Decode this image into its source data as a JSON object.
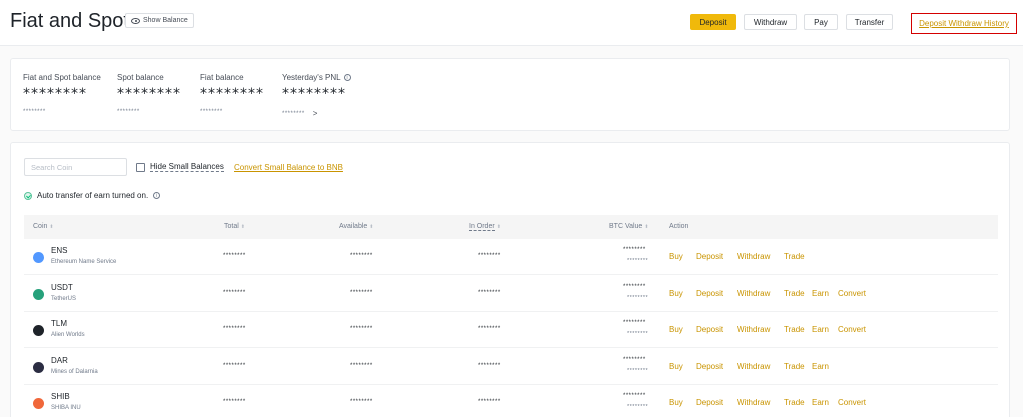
{
  "header": {
    "title": "Fiat and Spot",
    "show_balance": "Show Balance",
    "buttons": {
      "deposit": "Deposit",
      "withdraw": "Withdraw",
      "pay": "Pay",
      "transfer": "Transfer"
    },
    "history_link": "Deposit Withdraw History",
    "highlight_color": "#d40000",
    "accent_color": "#f0b90b"
  },
  "balances": [
    {
      "label": "Fiat and Spot balance",
      "value": "********",
      "sub": "********"
    },
    {
      "label": "Spot balance",
      "value": "********",
      "sub": "********"
    },
    {
      "label": "Fiat balance",
      "value": "********",
      "sub": "********"
    },
    {
      "label": "Yesterday's PNL",
      "value": "********",
      "sub": "********",
      "chevron": ">"
    }
  ],
  "filters": {
    "search_placeholder": "Search Coin",
    "hide_small": "Hide Small Balances",
    "convert_link": "Convert Small Balance to BNB",
    "auto_transfer": "Auto transfer of earn turned on."
  },
  "table": {
    "headers": {
      "coin": "Coin",
      "total": "Total",
      "available": "Available",
      "in_order": "In Order",
      "btc_value": "BTC Value",
      "action": "Action"
    },
    "rows": [
      {
        "symbol": "ENS",
        "name": "Ethereum Name Service",
        "icon": "ens-icon",
        "color": "#5298ff",
        "total": "********",
        "available": "********",
        "in_order": "********",
        "btc1": "********",
        "btc2": "********",
        "actions": [
          "Buy",
          "Deposit",
          "Withdraw",
          "Trade"
        ]
      },
      {
        "symbol": "USDT",
        "name": "TetherUS",
        "icon": "usdt-icon",
        "color": "#26a17b",
        "total": "********",
        "available": "********",
        "in_order": "********",
        "btc1": "********",
        "btc2": "********",
        "actions": [
          "Buy",
          "Deposit",
          "Withdraw",
          "Trade",
          "Earn",
          "Convert"
        ]
      },
      {
        "symbol": "TLM",
        "name": "Alien Worlds",
        "icon": "tlm-icon",
        "color": "#1e2329",
        "total": "********",
        "available": "********",
        "in_order": "********",
        "btc1": "********",
        "btc2": "********",
        "actions": [
          "Buy",
          "Deposit",
          "Withdraw",
          "Trade",
          "Earn",
          "Convert"
        ]
      },
      {
        "symbol": "DAR",
        "name": "Mines of Dalarnia",
        "icon": "dar-icon",
        "color": "#2b2d42",
        "total": "********",
        "available": "********",
        "in_order": "********",
        "btc1": "********",
        "btc2": "********",
        "actions": [
          "Buy",
          "Deposit",
          "Withdraw",
          "Trade",
          "Earn"
        ]
      },
      {
        "symbol": "SHIB",
        "name": "SHIBA INU",
        "icon": "shib-icon",
        "color": "#f0673a",
        "total": "********",
        "available": "********",
        "in_order": "********",
        "btc1": "********",
        "btc2": "********",
        "actions": [
          "Buy",
          "Deposit",
          "Withdraw",
          "Trade",
          "Earn",
          "Convert"
        ]
      }
    ]
  }
}
